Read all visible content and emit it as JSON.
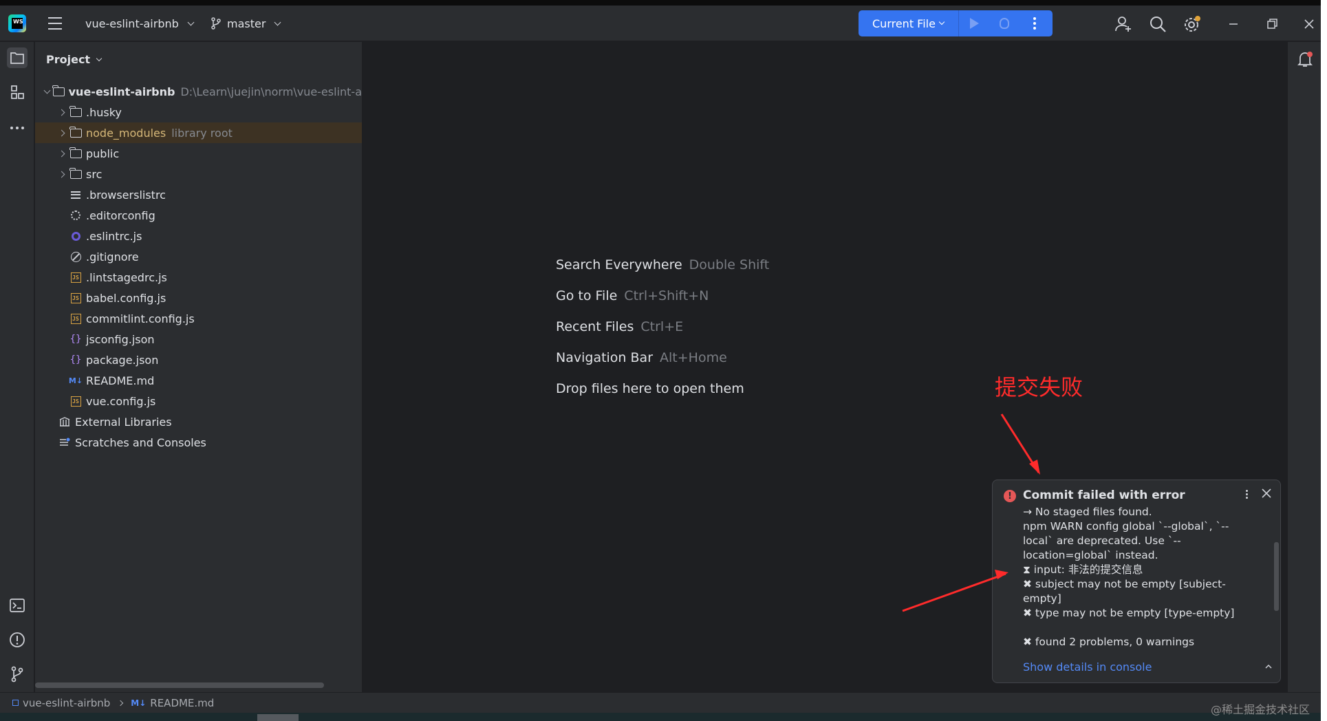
{
  "titlebar": {
    "project_name": "vue-eslint-airbnb",
    "branch": "master",
    "run_config": "Current File",
    "logo_text": "WS"
  },
  "panel": {
    "title": "Project"
  },
  "tree": {
    "root": {
      "label": "vue-eslint-airbnb",
      "path": "D:\\Learn\\juejin\\norm\\vue-eslint-a"
    },
    "items": [
      {
        "label": ".husky",
        "kind": "folder"
      },
      {
        "label": "node_modules",
        "kind": "folder",
        "hint": "library root"
      },
      {
        "label": "public",
        "kind": "folder"
      },
      {
        "label": "src",
        "kind": "folder"
      },
      {
        "label": ".browserslistrc",
        "kind": "lines-file"
      },
      {
        "label": ".editorconfig",
        "kind": "gear-file"
      },
      {
        "label": ".eslintrc.js",
        "kind": "eslint-file"
      },
      {
        "label": ".gitignore",
        "kind": "ignore-file"
      },
      {
        "label": ".lintstagedrc.js",
        "kind": "js-file"
      },
      {
        "label": "babel.config.js",
        "kind": "js-file"
      },
      {
        "label": "commitlint.config.js",
        "kind": "js-file"
      },
      {
        "label": "jsconfig.json",
        "kind": "json-file"
      },
      {
        "label": "package.json",
        "kind": "json-file"
      },
      {
        "label": "README.md",
        "kind": "md-file"
      },
      {
        "label": "vue.config.js",
        "kind": "js-file"
      }
    ],
    "external_libraries": "External Libraries",
    "scratches": "Scratches and Consoles"
  },
  "editor": {
    "hints": [
      {
        "action": "Search Everywhere",
        "keys": "Double Shift"
      },
      {
        "action": "Go to File",
        "keys": "Ctrl+Shift+N"
      },
      {
        "action": "Recent Files",
        "keys": "Ctrl+E"
      },
      {
        "action": "Navigation Bar",
        "keys": "Alt+Home"
      },
      {
        "action": "Drop files here to open them",
        "keys": ""
      }
    ]
  },
  "notification": {
    "title": "Commit failed with error",
    "lines": [
      "→ No staged files found.",
      "npm WARN config global `--global`, `--local` are deprecated. Use `--location=global` instead.",
      "⧗ input: 非法的提交信息",
      "✖ subject may not be empty [subject-empty]",
      "✖ type may not be empty [type-empty]",
      "",
      "✖ found 2 problems, 0 warnings"
    ],
    "link": "Show details in console"
  },
  "annotation": {
    "label": "提交失败",
    "color": "#ff2b2b"
  },
  "statusbar": {
    "project": "vue-eslint-airbnb",
    "file": "README.md",
    "file_badge": "M↓"
  },
  "watermark": "@稀土掘金技术社区",
  "colors": {
    "accent": "#3574f0",
    "error": "#e55757",
    "link": "#548af7",
    "library": "#d5b778"
  }
}
